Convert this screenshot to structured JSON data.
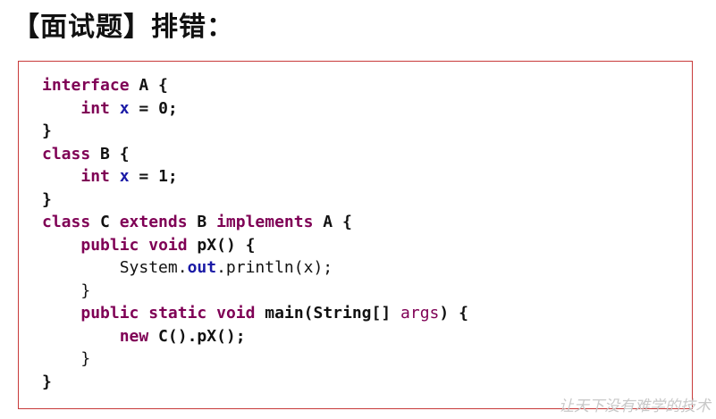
{
  "title": "【面试题】排错：",
  "code": {
    "l1": {
      "kw": "interface",
      "rest": " A {"
    },
    "l2": {
      "indent": "    ",
      "kw": "int",
      "sp": " ",
      "field": "x",
      "rest": " = 0;"
    },
    "l3": {
      "text": "}"
    },
    "l4": {
      "kw": "class",
      "rest": " B {"
    },
    "l5": {
      "indent": "    ",
      "kw": "int",
      "sp": " ",
      "field": "x",
      "rest": " = 1;"
    },
    "l6": {
      "text": "}"
    },
    "l7": {
      "kw1": "class",
      "mid1": " C ",
      "kw2": "extends",
      "mid2": " B ",
      "kw3": "implements",
      "rest": " A {"
    },
    "l8": {
      "indent": "    ",
      "kw1": "public",
      "sp": " ",
      "kw2": "void",
      "rest": " pX() {"
    },
    "l9": {
      "indent": "        ",
      "pre": "System.",
      "field": "out",
      "rest": ".println(x);"
    },
    "l10": {
      "indent": "    ",
      "text": "}"
    },
    "l11": {
      "indent": "    ",
      "kw1": "public",
      "sp1": " ",
      "kw2": "static",
      "sp2": " ",
      "kw3": "void",
      "mid": " main(String[] ",
      "param": "args",
      "rest": ") {"
    },
    "l12": {
      "indent": "        ",
      "kw": "new",
      "rest": " C().pX();"
    },
    "l13": {
      "indent": "    ",
      "text": "}"
    },
    "l14": {
      "text": "}"
    }
  },
  "watermark": "让天下没有难学的技术"
}
